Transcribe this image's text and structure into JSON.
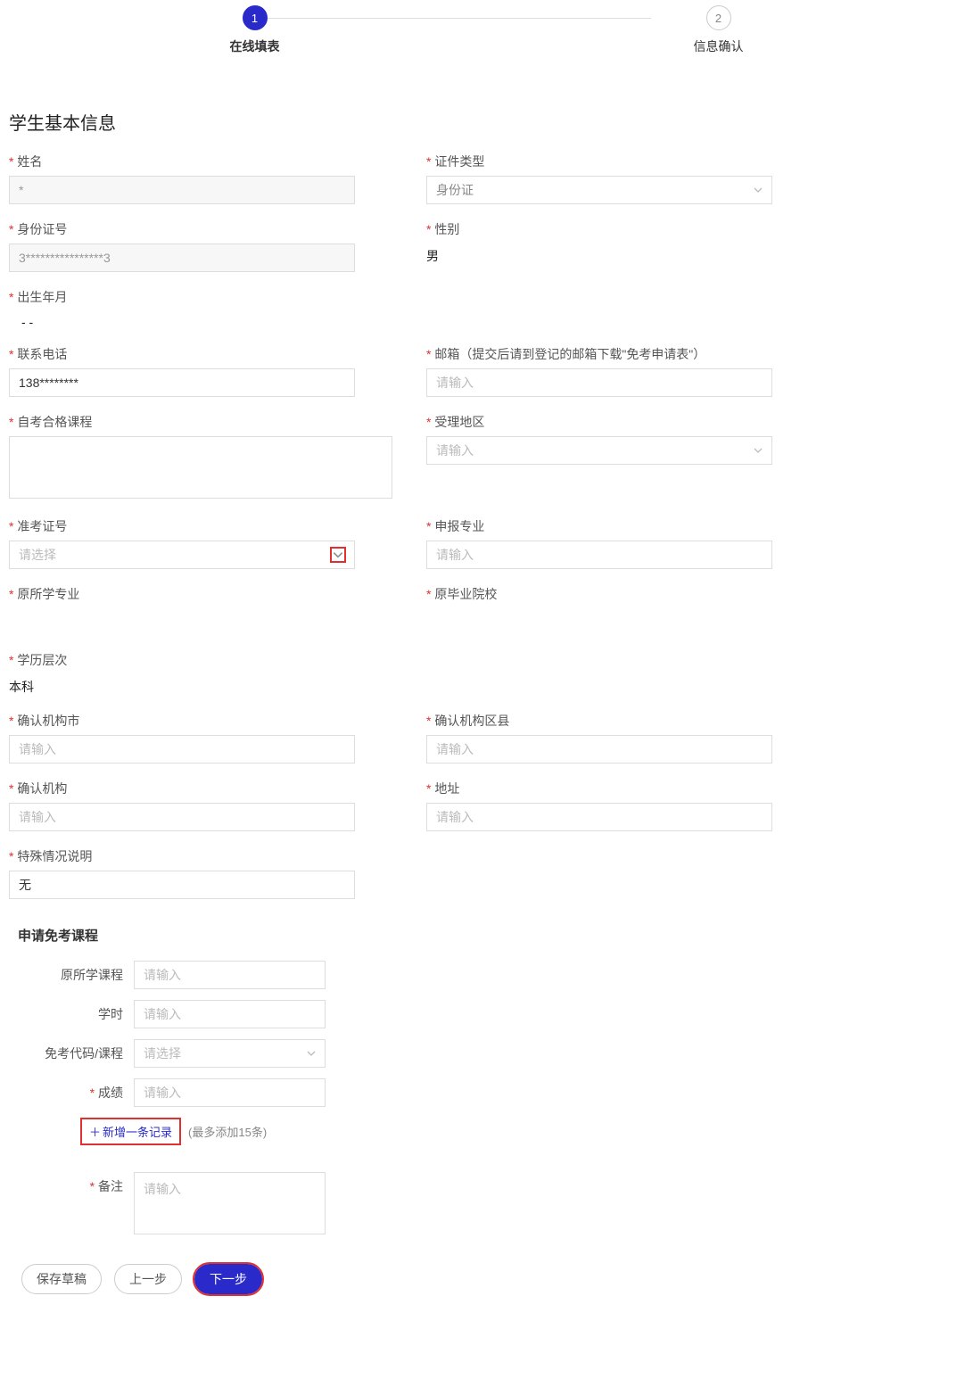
{
  "steps": {
    "items": [
      {
        "num": "1",
        "label": "在线填表",
        "active": true
      },
      {
        "num": "2",
        "label": "信息确认",
        "active": false
      }
    ]
  },
  "section": {
    "basic_title": "学生基本信息",
    "exemption_title": "申请免考课程"
  },
  "labels": {
    "name": "姓名",
    "id_type": "证件类型",
    "id_number": "身份证号",
    "gender": "性别",
    "birth": "出生年月",
    "phone": "联系电话",
    "email": "邮箱（提交后请到登记的邮箱下载\"免考申请表\"）",
    "self_course": "自考合格课程",
    "region": "受理地区",
    "ticket_no": "准考证号",
    "major_apply": "申报专业",
    "orig_major": "原所学专业",
    "orig_school": "原毕业院校",
    "edu_level": "学历层次",
    "confirm_city": "确认机构市",
    "confirm_district": "确认机构区县",
    "confirm_org": "确认机构",
    "address": "地址",
    "special": "特殊情况说明",
    "sub_orig_course": "原所学课程",
    "sub_hours": "学时",
    "sub_exempt_code": "免考代码/课程",
    "sub_score": "成绩",
    "remark": "备注"
  },
  "placeholders": {
    "input": "请输入",
    "select": "请选择"
  },
  "values": {
    "name": "*",
    "id_type": "身份证",
    "id_number": "3****************3",
    "gender": "男",
    "birth": "    -    -",
    "phone": "138********",
    "edu_level": "本科",
    "special": "无"
  },
  "buttons": {
    "add_record": "新增一条记录",
    "save_draft": "保存草稿",
    "prev": "上一步",
    "next": "下一步"
  },
  "hint": {
    "max_add": "(最多添加15条)"
  }
}
